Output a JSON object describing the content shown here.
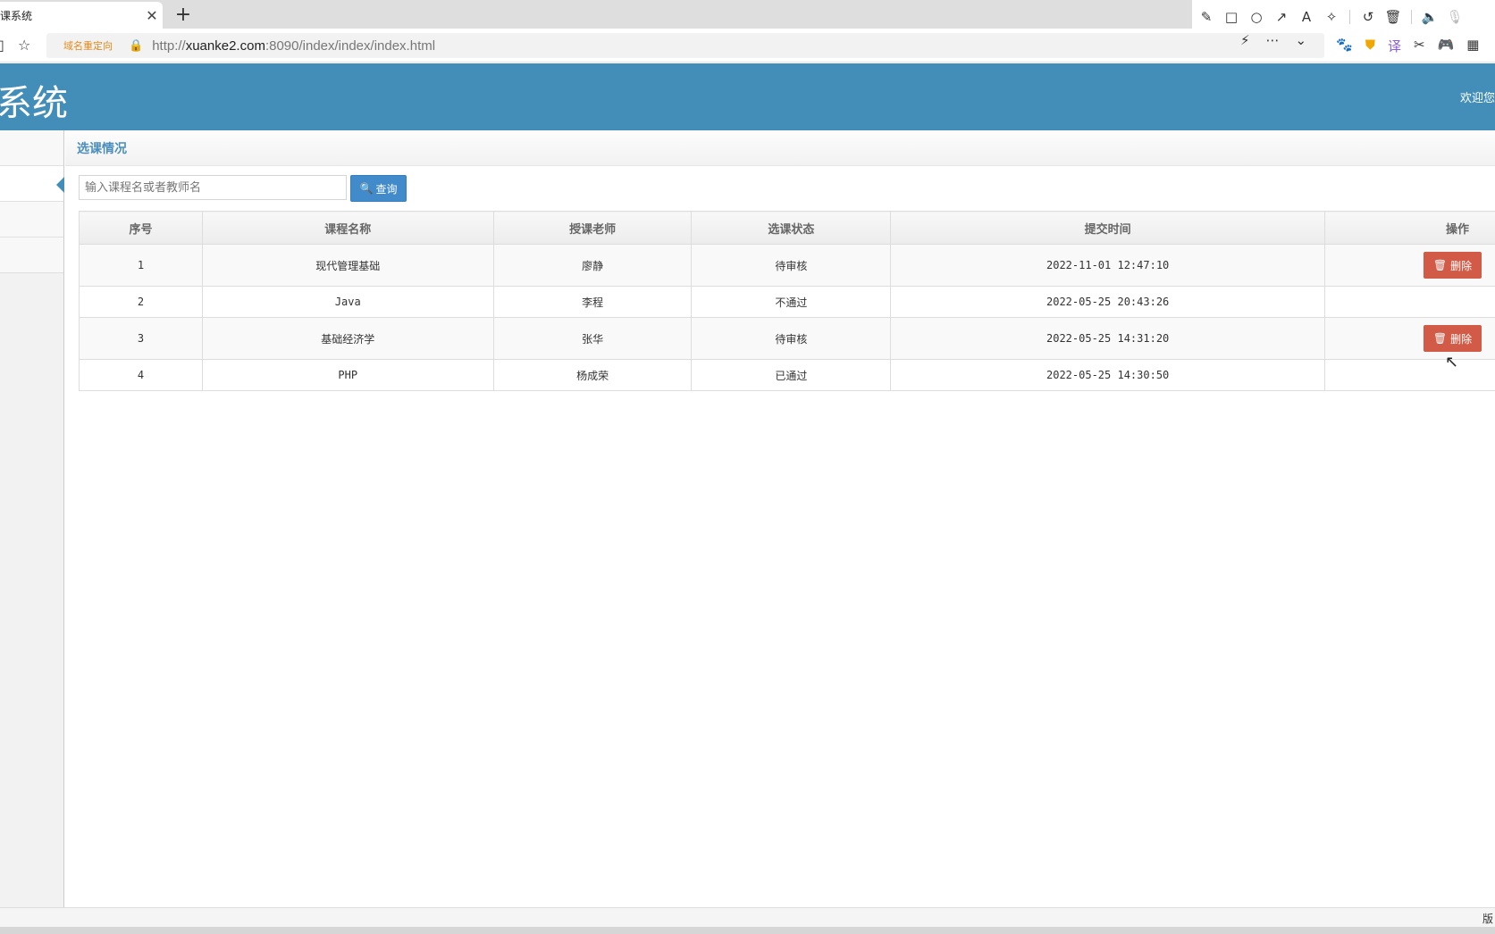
{
  "browser": {
    "tab_title": "选课系统",
    "tab_title_visible": "选课系统",
    "url_prefix": "http://",
    "url_host": "xuanke2.com",
    "url_rest": ":8090/index/index/index.html",
    "redirect_label": "域名重定向"
  },
  "header": {
    "app_title": "系统",
    "welcome": "欢迎您"
  },
  "breadcrumb": {
    "current": "选课情况"
  },
  "search": {
    "placeholder": "输入课程名或者教师名",
    "button_label": "查询"
  },
  "table": {
    "columns": [
      "序号",
      "课程名称",
      "授课老师",
      "选课状态",
      "提交时间",
      "操作"
    ],
    "rows": [
      {
        "id": "1",
        "course": "现代管理基础",
        "teacher": "廖静",
        "status": "待审核",
        "time": "2022-11-01 12:47:10",
        "action": "删除"
      },
      {
        "id": "2",
        "course": "Java",
        "teacher": "李程",
        "status": "不通过",
        "time": "2022-05-25 20:43:26",
        "action": ""
      },
      {
        "id": "3",
        "course": "基础经济学",
        "teacher": "张华",
        "status": "待审核",
        "time": "2022-05-25 14:31:20",
        "action": "删除"
      },
      {
        "id": "4",
        "course": "PHP",
        "teacher": "杨成荣",
        "status": "已通过",
        "time": "2022-05-25 14:30:50",
        "action": ""
      }
    ]
  },
  "statusbar": {
    "right_text": "版"
  },
  "colors": {
    "header_bg": "#438eb9",
    "query_button": "#428bca",
    "delete_button": "#d15b47",
    "breadcrumb_text": "#4c8fbd"
  }
}
